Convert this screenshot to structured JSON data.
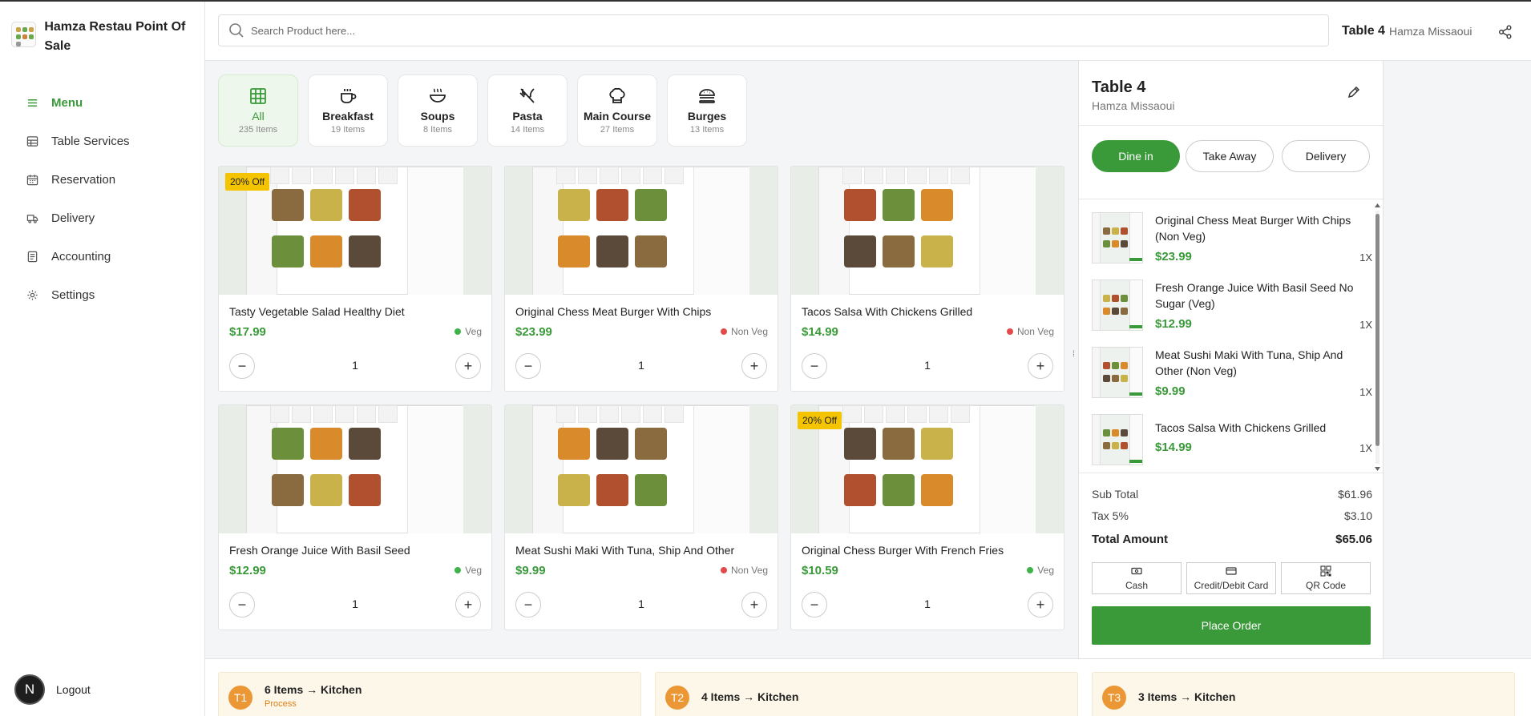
{
  "brand": {
    "title": "Hamza Restau Point Of Sale"
  },
  "nav": [
    {
      "label": "Menu",
      "icon": "menu-icon",
      "active": true
    },
    {
      "label": "Table Services",
      "icon": "table-icon"
    },
    {
      "label": "Reservation",
      "icon": "calendar-icon"
    },
    {
      "label": "Delivery",
      "icon": "truck-icon"
    },
    {
      "label": "Accounting",
      "icon": "ledger-icon"
    },
    {
      "label": "Settings",
      "icon": "gear-icon"
    }
  ],
  "logout": {
    "avatar": "N",
    "label": "Logout"
  },
  "search": {
    "placeholder": "Search Product here..."
  },
  "header": {
    "table": "Table 4",
    "waiter": "Hamza Missaoui"
  },
  "categories": [
    {
      "name": "All",
      "count": "235 Items",
      "icon": "grid-icon",
      "active": true
    },
    {
      "name": "Breakfast",
      "count": "19 Items",
      "icon": "coffee-icon"
    },
    {
      "name": "Soups",
      "count": "8 Items",
      "icon": "soup-bowl-icon"
    },
    {
      "name": "Pasta",
      "count": "14 Items",
      "icon": "fork-knife-icon"
    },
    {
      "name": "Main Course",
      "count": "27 Items",
      "icon": "chef-hat-icon"
    },
    {
      "name": "Burges",
      "count": "13 Items",
      "icon": "burger-icon"
    }
  ],
  "products": [
    {
      "name": "Tasty Vegetable Salad Healthy Diet",
      "price": "$17.99",
      "type": "Veg",
      "badge": "20% Off",
      "qty": "1"
    },
    {
      "name": "Original Chess Meat Burger With Chips",
      "price": "$23.99",
      "type": "Non Veg",
      "badge": "",
      "qty": "1"
    },
    {
      "name": "Tacos Salsa With Chickens Grilled",
      "price": "$14.99",
      "type": "Non Veg",
      "badge": "",
      "qty": "1"
    },
    {
      "name": "Fresh Orange Juice With Basil Seed",
      "price": "$12.99",
      "type": "Veg",
      "badge": "",
      "qty": "1"
    },
    {
      "name": "Meat Sushi Maki With Tuna, Ship And Other",
      "price": "$9.99",
      "type": "Non Veg",
      "badge": "",
      "qty": "1"
    },
    {
      "name": "Original Chess Burger With French Fries",
      "price": "$10.59",
      "type": "Veg",
      "badge": "20% Off",
      "qty": "1"
    }
  ],
  "order": {
    "title": "Table 4",
    "waiter": "Hamza Missaoui",
    "types": [
      {
        "label": "Dine in",
        "active": true
      },
      {
        "label": "Take Away"
      },
      {
        "label": "Delivery"
      }
    ],
    "items": [
      {
        "name": "Original Chess Meat Burger With Chips (Non Veg)",
        "price": "$23.99",
        "qty": "1X"
      },
      {
        "name": "Fresh Orange Juice With Basil Seed No Sugar (Veg)",
        "price": "$12.99",
        "qty": "1X"
      },
      {
        "name": "Meat Sushi Maki With Tuna, Ship And Other (Non Veg)",
        "price": "$9.99",
        "qty": "1X"
      },
      {
        "name": "Tacos Salsa With Chickens Grilled",
        "price": "$14.99",
        "qty": "1X"
      }
    ],
    "subtotal_label": "Sub Total",
    "subtotal": "$61.96",
    "tax_label": "Tax 5%",
    "tax": "$3.10",
    "total_label": "Total Amount",
    "total": "$65.06",
    "payments": [
      {
        "label": "Cash",
        "icon": "cash-icon"
      },
      {
        "label": "Credit/Debit Card",
        "icon": "card-icon"
      },
      {
        "label": "QR Code",
        "icon": "qr-code-icon"
      }
    ],
    "place_order": "Place Order"
  },
  "kitchen": [
    {
      "avatar": "T1",
      "text": "6 Items → Kitchen",
      "status": "Process"
    },
    {
      "avatar": "T2",
      "text": "4 Items → Kitchen",
      "status": ""
    },
    {
      "avatar": "T3",
      "text": "3 Items → Kitchen",
      "status": ""
    }
  ],
  "colors": {
    "accent": "#3a9a3a",
    "veg": "#3fb24a",
    "nonveg": "#e34b4b",
    "badge": "#f4c400",
    "kitchen_avatar": "#ec9735"
  }
}
